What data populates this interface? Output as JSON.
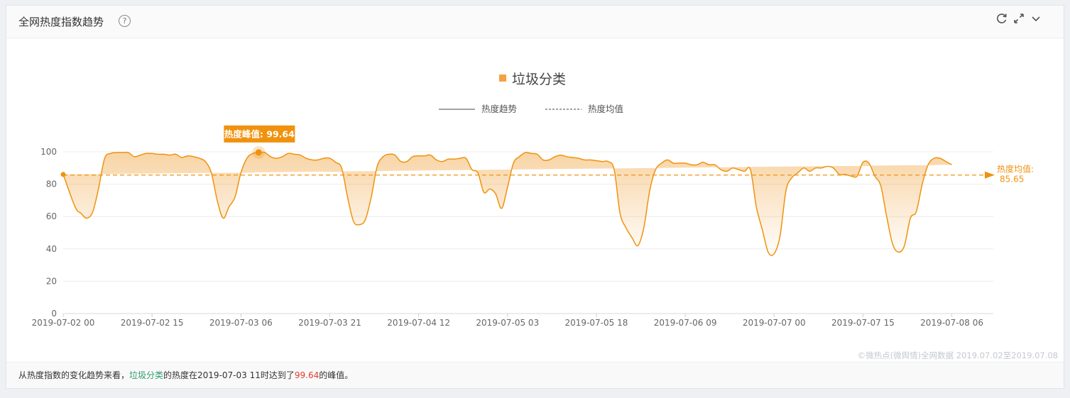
{
  "header": {
    "title": "全网热度指数趋势",
    "help_icon": "?",
    "icons": [
      "refresh-icon",
      "expand-icon",
      "chevron-down-icon"
    ]
  },
  "chart_data": {
    "type": "area",
    "title": "垃圾分类",
    "legend": {
      "placement": "top-center",
      "entries": [
        {
          "name": "热度趋势",
          "style": "solid"
        },
        {
          "name": "热度均值",
          "style": "dashed"
        }
      ]
    },
    "ylim": [
      0,
      100
    ],
    "y_ticks": [
      "0",
      "20",
      "40",
      "60",
      "80",
      "100"
    ],
    "x_tick_labels": [
      "2019-07-02 00",
      "2019-07-02 15",
      "2019-07-03 06",
      "2019-07-03 21",
      "2019-07-04 12",
      "2019-07-05 03",
      "2019-07-05 18",
      "2019-07-06 09",
      "2019-07-07 00",
      "2019-07-07 15",
      "2019-07-08 06"
    ],
    "x_start": "2019-07-02 00",
    "series": [
      {
        "name": "热度趋势",
        "x_hours": [
          0,
          2,
          3,
          4,
          5,
          6,
          7,
          8,
          9,
          10,
          11,
          12,
          13,
          14,
          15,
          16,
          17,
          18,
          19,
          20,
          21,
          22,
          23,
          24,
          25,
          26,
          27,
          28,
          29,
          30,
          31,
          32,
          33,
          34,
          35,
          36,
          37,
          38,
          39,
          40,
          41,
          42,
          43,
          44,
          45,
          46,
          47,
          48,
          49,
          50,
          51,
          52,
          53,
          54,
          55,
          56,
          57,
          58,
          59,
          60,
          61,
          62,
          63,
          64,
          65,
          66,
          67,
          68,
          69,
          70,
          71,
          72,
          73,
          74,
          75,
          76,
          77,
          78,
          79,
          80,
          81,
          82,
          83,
          84,
          85,
          86,
          87,
          88,
          89,
          90,
          91,
          92,
          93,
          94,
          95,
          96,
          97,
          98,
          99,
          100,
          101,
          102,
          103,
          104,
          105,
          106,
          107,
          108,
          109,
          110,
          111,
          112,
          113,
          114,
          115,
          116,
          117,
          118,
          119,
          120,
          121,
          122,
          123,
          124,
          125,
          126,
          127,
          128,
          129,
          130,
          131,
          132,
          133,
          134,
          135,
          136,
          137,
          138,
          139,
          140,
          141,
          142,
          143,
          144,
          145,
          146,
          147,
          148,
          149,
          150,
          151,
          152,
          153,
          154,
          155,
          156,
          157
        ],
        "values": [
          86,
          66,
          62,
          59,
          63,
          78,
          96,
          99,
          99.5,
          99.5,
          99.5,
          97,
          98,
          99,
          99,
          98.5,
          98.5,
          98,
          98.5,
          96.5,
          97.5,
          97,
          96,
          94,
          87,
          70,
          59,
          66,
          72,
          87,
          96,
          99,
          99.5,
          99.64,
          97,
          96,
          97,
          99,
          98.5,
          98,
          96,
          95,
          95,
          96,
          96,
          93.5,
          90,
          72,
          57,
          55,
          58,
          72,
          91,
          97,
          98.5,
          98,
          94,
          94,
          97,
          97.5,
          97.5,
          98,
          95,
          94,
          95.5,
          95.5,
          96,
          96,
          89,
          87,
          75,
          77,
          74,
          65,
          78,
          93,
          97,
          99.5,
          99,
          98.5,
          95,
          95,
          97,
          98,
          97,
          96.5,
          96,
          95,
          95,
          94.5,
          94,
          94,
          89,
          62,
          53,
          47,
          42,
          53,
          76,
          89,
          93,
          95,
          93,
          93,
          93,
          92,
          92,
          93.5,
          92,
          92,
          89,
          88,
          90,
          89,
          88,
          89,
          66,
          52,
          38,
          37,
          48,
          76,
          84,
          87,
          90,
          88,
          90,
          90,
          91,
          90,
          86,
          86,
          85,
          85,
          93.5,
          93,
          85,
          79,
          60,
          43,
          38,
          42,
          59,
          63,
          80,
          92,
          96,
          96,
          94,
          92,
          91
        ]
      }
    ],
    "mean": {
      "name": "热度均值",
      "label": "热度均值:",
      "value": 85.65,
      "value_text": "85.65"
    },
    "peak": {
      "label": "热度峰值: 99.64",
      "value": 99.64,
      "x_hour": 33
    },
    "colors": {
      "line": "#f0920e",
      "area_top": "#f1a94a",
      "mean": "#f0920e",
      "marker_legend": "#f5a142",
      "peak_bg": "#f0920e"
    }
  },
  "watermark": "©微热点(微舆情)全网数据 2019.07.02至2019.07.08",
  "footer": {
    "prefix": "从热度指数的变化趋势来看，",
    "keyword": "垃圾分类",
    "middle": "的热度在2019-07-03 11时达到了",
    "peak_value": "99.64",
    "suffix": "的峰值。"
  }
}
